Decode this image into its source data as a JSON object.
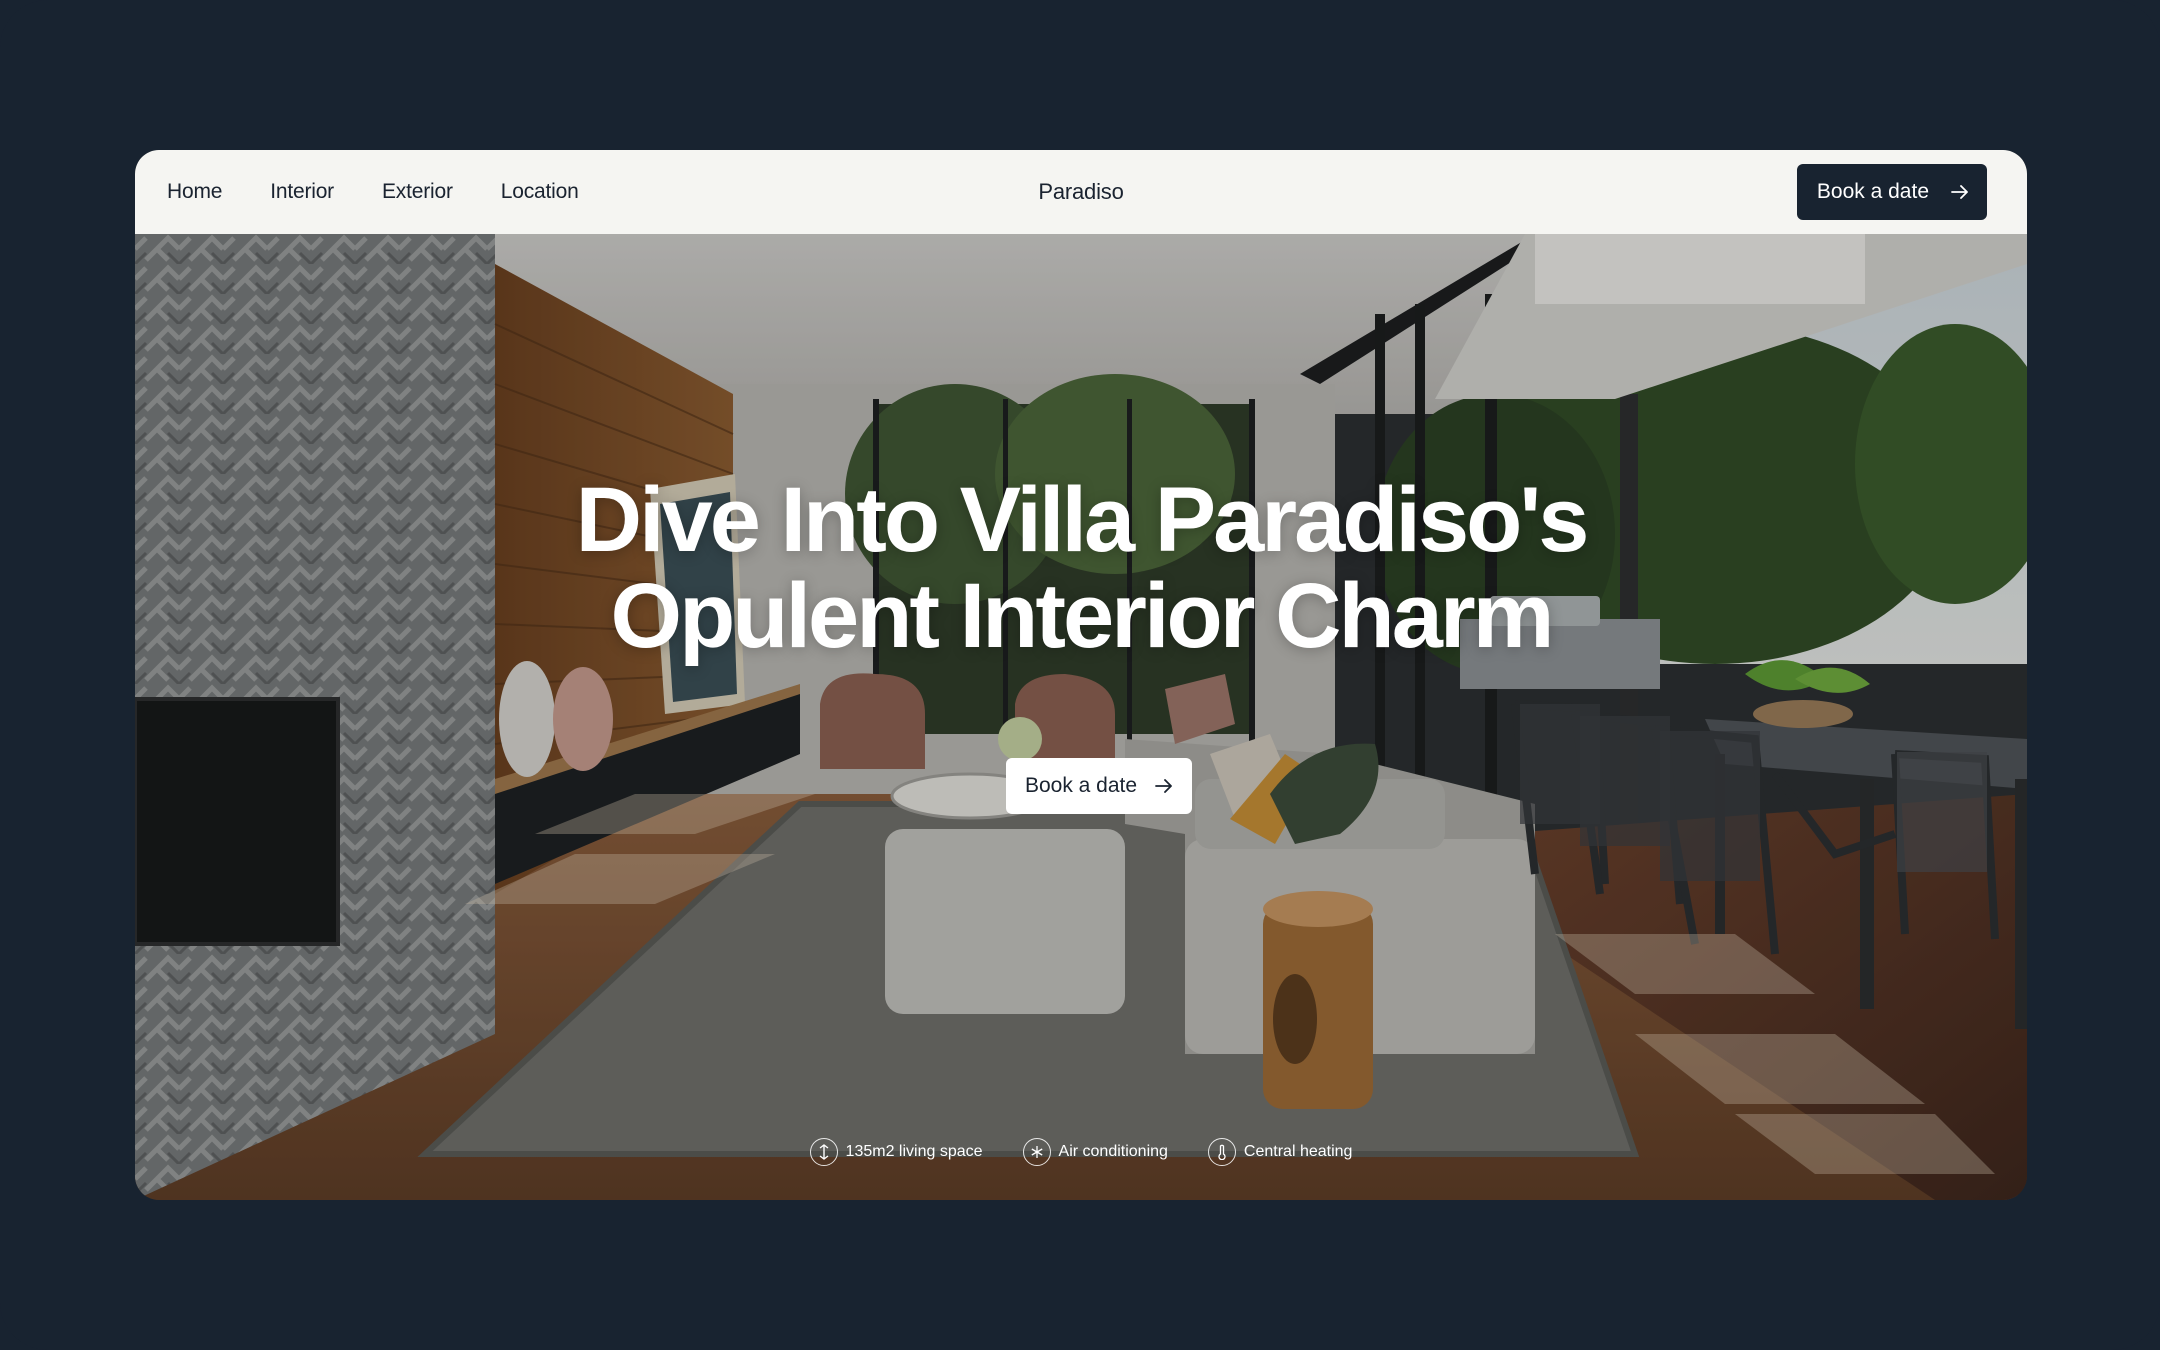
{
  "nav": {
    "links": [
      "Home",
      "Interior",
      "Exterior",
      "Location"
    ],
    "brand": "Paradiso",
    "cta_label": "Book a date"
  },
  "hero": {
    "headline_line1": "Dive Into Villa Paradiso's",
    "headline_line2": "Opulent Interior Charm",
    "cta_label": "Book a date",
    "features": [
      {
        "icon": "area-icon",
        "label": "135m2 living space"
      },
      {
        "icon": "snowflake-icon",
        "label": "Air conditioning"
      },
      {
        "icon": "thermometer-icon",
        "label": "Central heating"
      }
    ]
  },
  "colors": {
    "page_background": "#182330",
    "nav_background": "#f5f5f2",
    "primary_button": "#182330",
    "text_dark": "#1a2330"
  }
}
